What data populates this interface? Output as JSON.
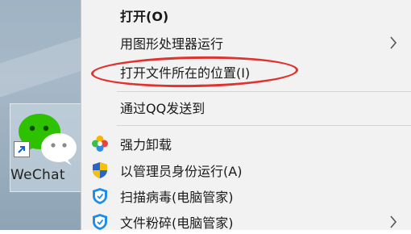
{
  "desktop": {
    "shortcut_label": "WeChat",
    "app_icon": "wechat-icon"
  },
  "menu": {
    "items": [
      {
        "label": "打开(O)",
        "bold": true
      },
      {
        "label": "用图形处理器运行",
        "submenu": true
      },
      {
        "label": "打开文件所在的位置(I)",
        "highlighted": true
      },
      {
        "label": "通过QQ发送到"
      },
      {
        "label": "强力卸载",
        "icon": "colorful-flower-icon"
      },
      {
        "label": "以管理员身份运行(A)",
        "icon": "uac-shield-icon"
      },
      {
        "label": "扫描病毒(电脑管家)",
        "icon": "pc-manager-shield-icon"
      },
      {
        "label": "文件粉碎(电脑管家)",
        "icon": "pc-manager-shield-icon",
        "submenu": true
      }
    ]
  },
  "colors": {
    "menu_bg": "#f2f2f2",
    "highlight_circle": "#e0322f",
    "wechat_green": "#2dc100"
  }
}
